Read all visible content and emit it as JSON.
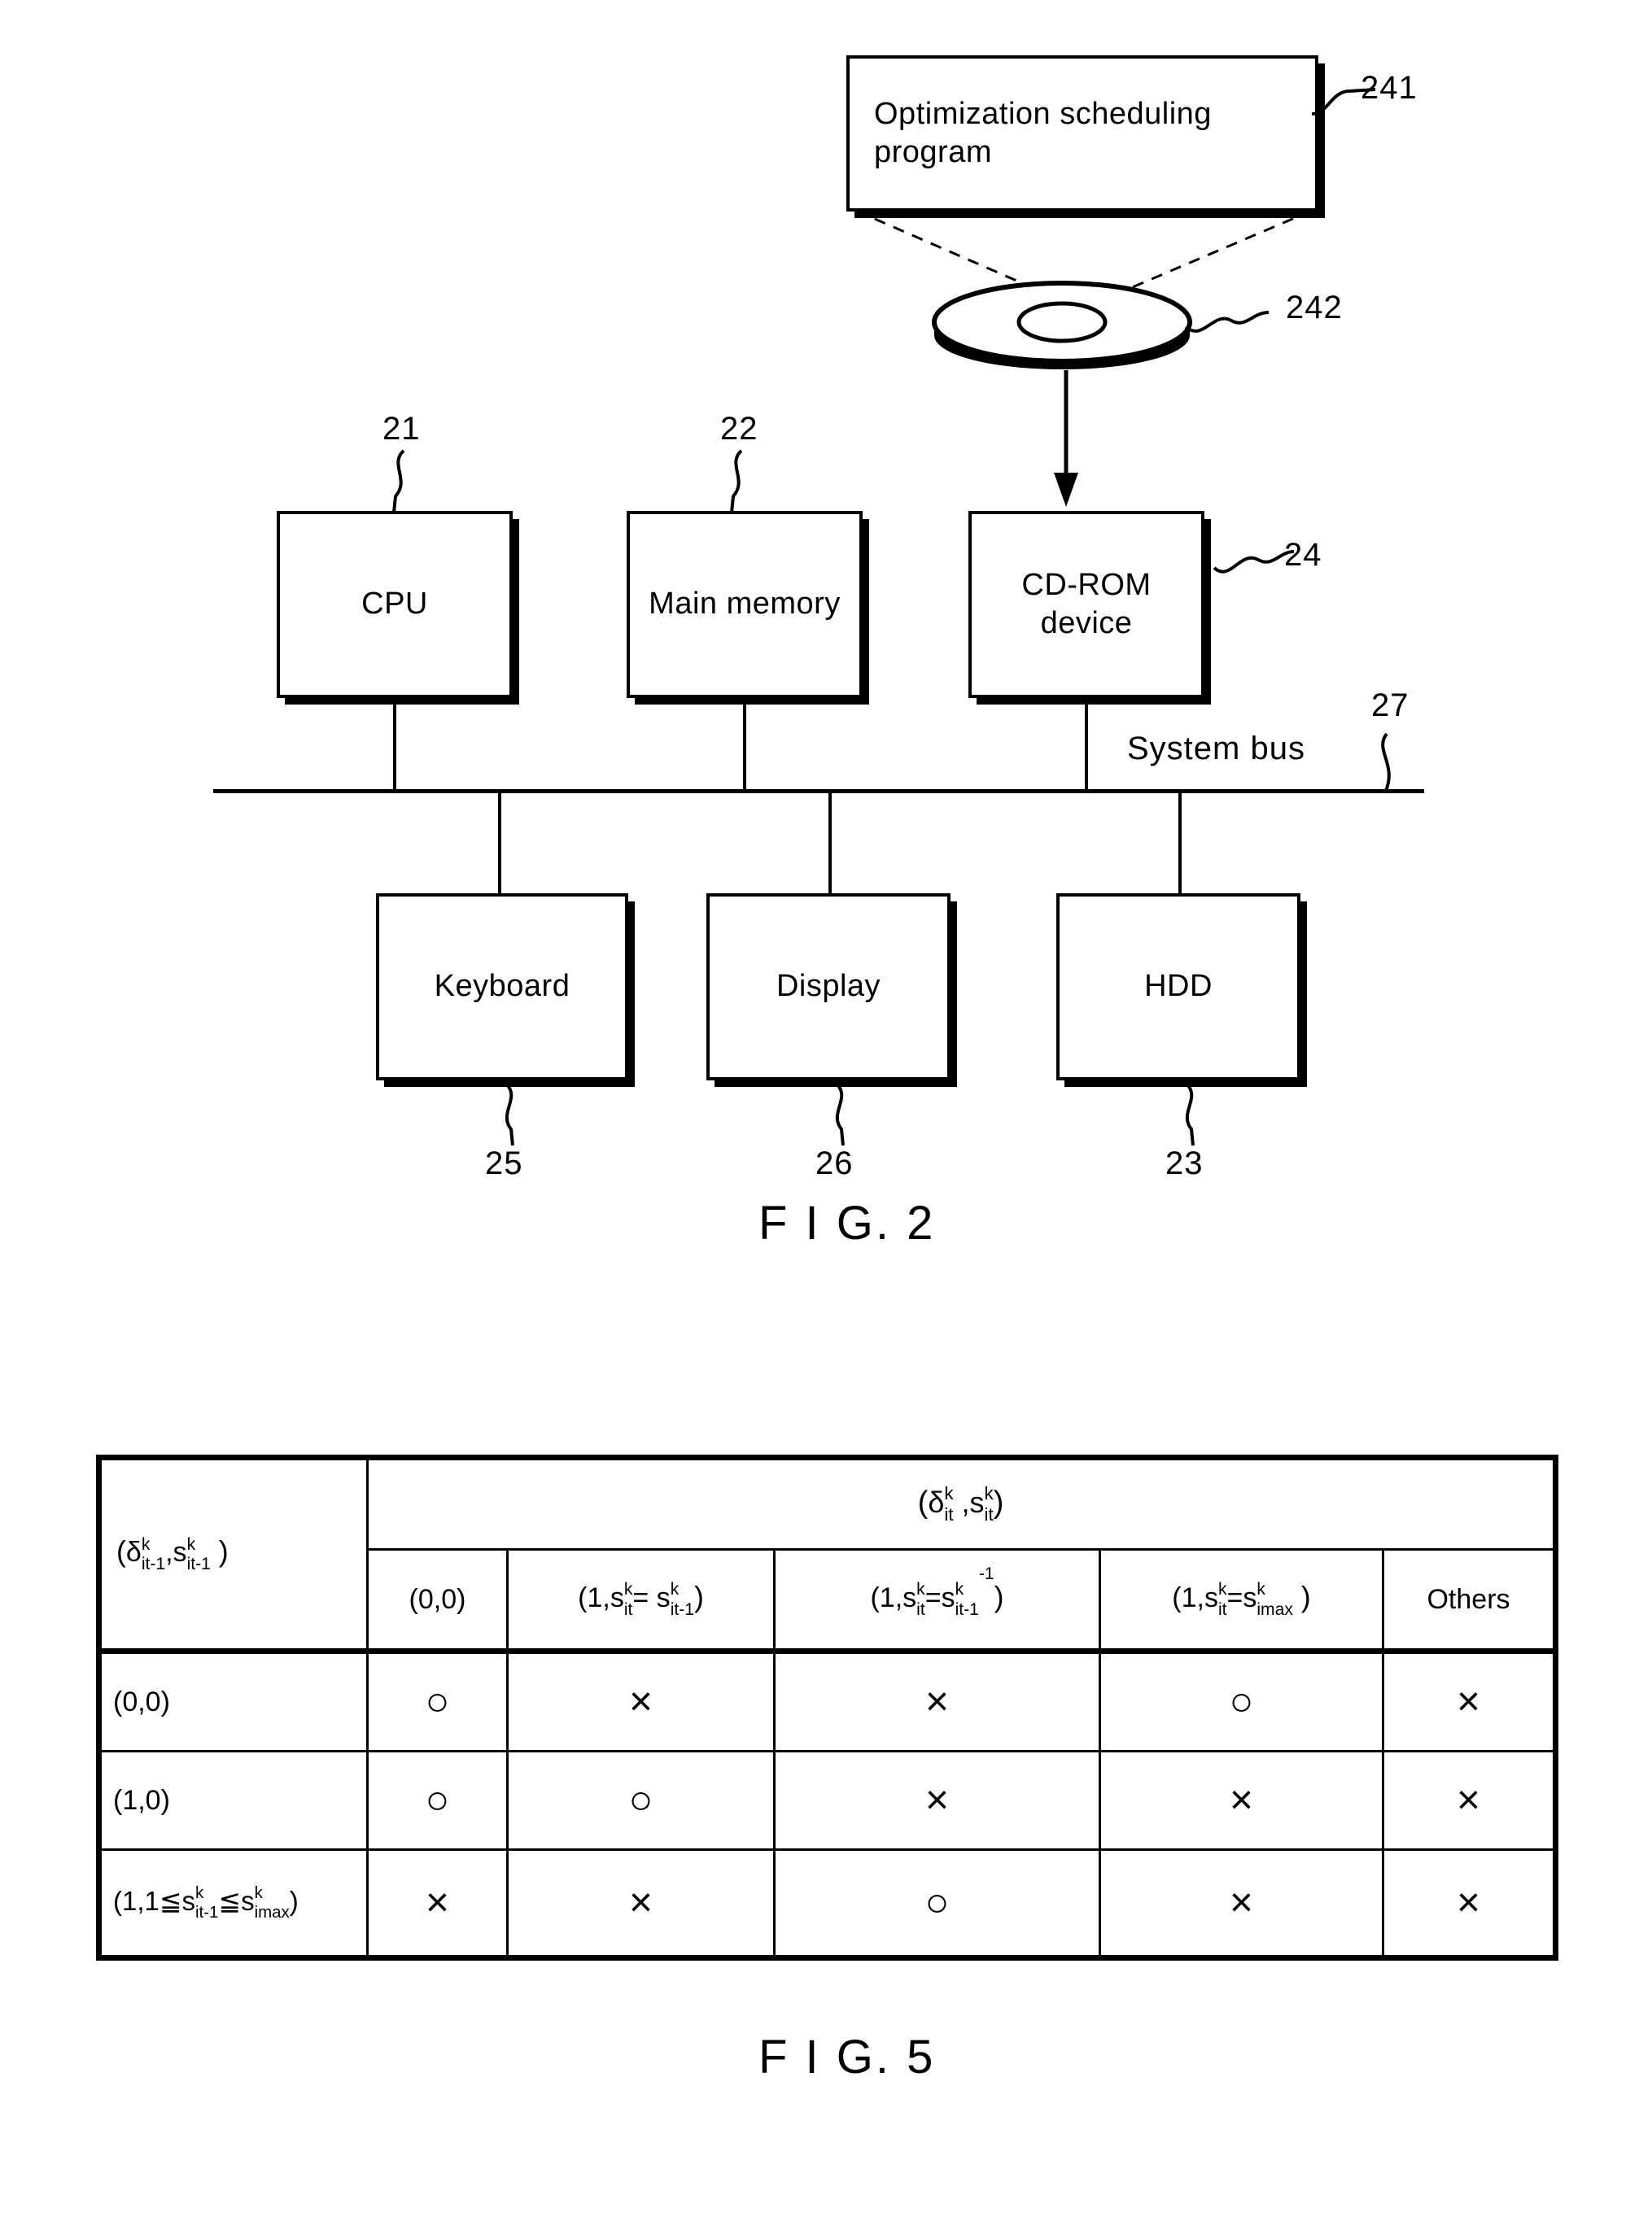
{
  "figure2": {
    "caption": "F I G. 2",
    "program_box": {
      "label": "Optimization scheduling program",
      "ref": "241"
    },
    "cd_media": {
      "ref": "242",
      "icon": "cd-disc-icon"
    },
    "components_top": [
      {
        "label": "CPU",
        "ref": "21",
        "ref_pos": "top"
      },
      {
        "label": "Main memory",
        "ref": "22",
        "ref_pos": "top"
      },
      {
        "label": "CD-ROM device",
        "ref": "24",
        "ref_pos": "right"
      }
    ],
    "components_bottom": [
      {
        "label": "Keyboard",
        "ref": "25",
        "ref_pos": "bottom"
      },
      {
        "label": "Display",
        "ref": "26",
        "ref_pos": "bottom"
      },
      {
        "label": "HDD",
        "ref": "23",
        "ref_pos": "bottom"
      }
    ],
    "bus": {
      "label": "System bus",
      "ref": "27"
    }
  },
  "figure5": {
    "caption": "F I G. 5",
    "table": {
      "corner_header": {
        "text": "( δ it-1 k , s it-1 k )",
        "parts": {
          "open": "(",
          "delta": "δ",
          "sup1": "k",
          "sub1": "it-1",
          "comma": ",",
          "s": "s",
          "sup2": "k",
          "sub2": "it-1",
          "close": ")"
        }
      },
      "group_header": {
        "text": "( δ it k , s it k )",
        "parts": {
          "open": "(",
          "delta": "δ",
          "sup1": "k",
          "sub1": "it",
          "comma": ",",
          "s": "s",
          "sup2": "k",
          "sub2": "it",
          "close": ")"
        }
      },
      "col_headers": [
        {
          "id": "c00",
          "text": "(0,0)"
        },
        {
          "id": "c_same",
          "text": "(1,s it k = s it-1 k )"
        },
        {
          "id": "c_dec",
          "text": "(1,s it k = s it-1 k -1)"
        },
        {
          "id": "c_imax",
          "text": "(1,s it k = s imax k )"
        },
        {
          "id": "c_oth",
          "text": "Others"
        }
      ],
      "row_headers": [
        {
          "id": "r00",
          "text": "(0,0)"
        },
        {
          "id": "r10",
          "text": "(1,0)"
        },
        {
          "id": "rrange",
          "text": "(1,1≦s it-1 k ≦s imax k )"
        }
      ],
      "rows": [
        {
          "row": "r00",
          "cells": [
            "○",
            "×",
            "×",
            "○",
            "×"
          ]
        },
        {
          "row": "r10",
          "cells": [
            "○",
            "○",
            "×",
            "×",
            "×"
          ]
        },
        {
          "row": "rrange",
          "cells": [
            "×",
            "×",
            "○",
            "×",
            "×"
          ]
        }
      ],
      "symbols": {
        "allowed": "○",
        "not_allowed": "×"
      }
    }
  },
  "colors": {
    "ink": "#000000",
    "paper": "#ffffff"
  }
}
